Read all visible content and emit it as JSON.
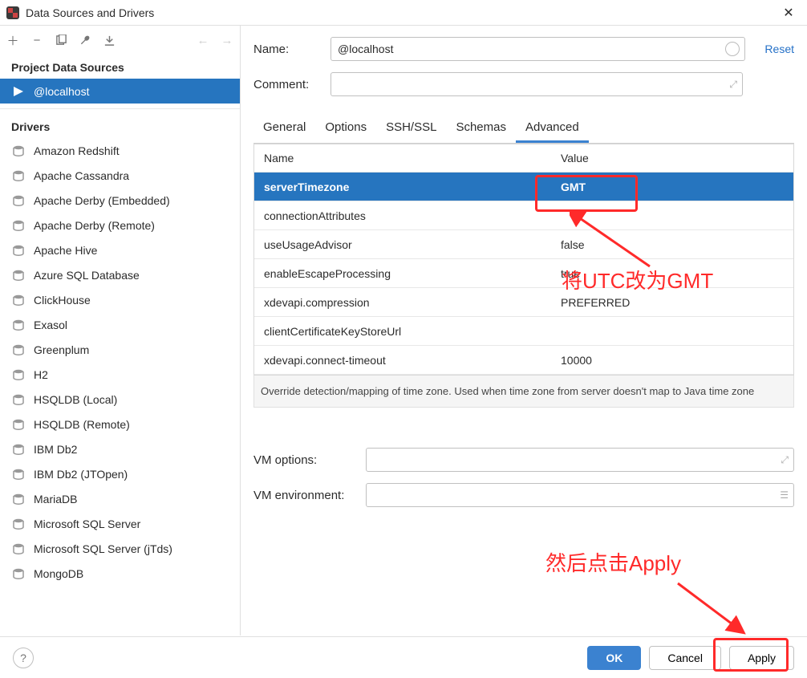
{
  "window": {
    "title": "Data Sources and Drivers"
  },
  "sidebar": {
    "section1": "Project Data Sources",
    "ds": [
      {
        "label": "@localhost"
      }
    ],
    "section2": "Drivers",
    "drivers": [
      {
        "label": "Amazon Redshift"
      },
      {
        "label": "Apache Cassandra"
      },
      {
        "label": "Apache Derby (Embedded)"
      },
      {
        "label": "Apache Derby (Remote)"
      },
      {
        "label": "Apache Hive"
      },
      {
        "label": "Azure SQL Database"
      },
      {
        "label": "ClickHouse"
      },
      {
        "label": "Exasol"
      },
      {
        "label": "Greenplum"
      },
      {
        "label": "H2"
      },
      {
        "label": "HSQLDB (Local)"
      },
      {
        "label": "HSQLDB (Remote)"
      },
      {
        "label": "IBM Db2"
      },
      {
        "label": "IBM Db2 (JTOpen)"
      },
      {
        "label": "MariaDB"
      },
      {
        "label": "Microsoft SQL Server"
      },
      {
        "label": "Microsoft SQL Server (jTds)"
      },
      {
        "label": "MongoDB"
      }
    ]
  },
  "form": {
    "name_label": "Name:",
    "name_value": "@localhost",
    "comment_label": "Comment:",
    "comment_value": "",
    "reset": "Reset",
    "vm_options_label": "VM options:",
    "vm_env_label": "VM environment:"
  },
  "tabs": {
    "t0": "General",
    "t1": "Options",
    "t2": "SSH/SSL",
    "t3": "Schemas",
    "t4": "Advanced"
  },
  "table": {
    "h_name": "Name",
    "h_value": "Value",
    "rows": [
      {
        "name": "serverTimezone",
        "value": "GMT"
      },
      {
        "name": "connectionAttributes",
        "value": ""
      },
      {
        "name": "useUsageAdvisor",
        "value": "false"
      },
      {
        "name": "enableEscapeProcessing",
        "value": "true"
      },
      {
        "name": "xdevapi.compression",
        "value": "PREFERRED"
      },
      {
        "name": "clientCertificateKeyStoreUrl",
        "value": ""
      },
      {
        "name": "xdevapi.connect-timeout",
        "value": "10000"
      }
    ],
    "hint": "Override detection/mapping of time zone. Used when time zone from server doesn't map to Java time zone"
  },
  "annotations": {
    "a1": "将UTC改为GMT",
    "a2": "然后点击Apply"
  },
  "footer": {
    "ok": "OK",
    "cancel": "Cancel",
    "apply": "Apply"
  }
}
